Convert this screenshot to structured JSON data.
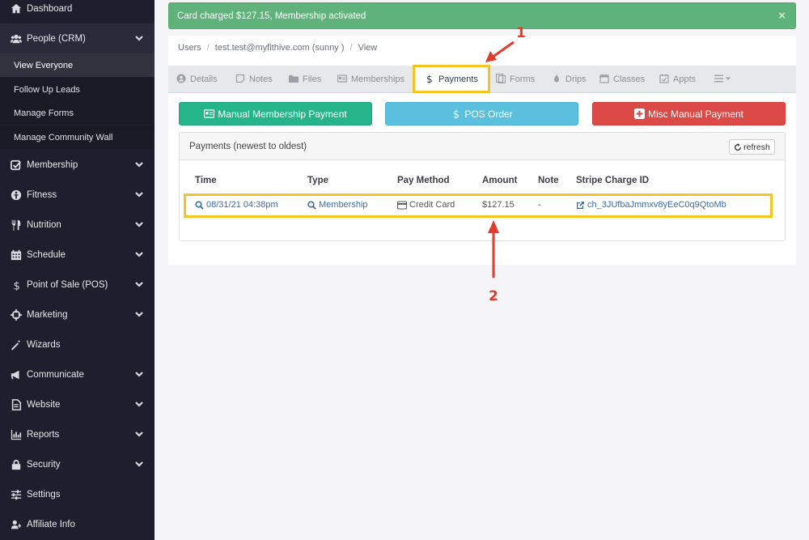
{
  "sidebar": {
    "items": [
      {
        "label": "Dashboard",
        "icon": "home-icon"
      },
      {
        "label": "People (CRM)",
        "icon": "users-icon",
        "open": true
      },
      {
        "label": "Membership",
        "icon": "check-square-icon"
      },
      {
        "label": "Fitness",
        "icon": "fitness-icon"
      },
      {
        "label": "Nutrition",
        "icon": "cutlery-icon"
      },
      {
        "label": "Schedule",
        "icon": "calendar-icon"
      },
      {
        "label": "Point of Sale (POS)",
        "icon": "dollar-icon"
      },
      {
        "label": "Marketing",
        "icon": "crosshair-icon"
      },
      {
        "label": "Wizards",
        "icon": "magic-wand-icon"
      },
      {
        "label": "Communicate",
        "icon": "bullhorn-icon"
      },
      {
        "label": "Website",
        "icon": "file-icon"
      },
      {
        "label": "Reports",
        "icon": "bar-chart-icon"
      },
      {
        "label": "Security",
        "icon": "lock-icon"
      },
      {
        "label": "Settings",
        "icon": "sliders-icon"
      },
      {
        "label": "Affiliate Info",
        "icon": "affiliate-icon"
      }
    ],
    "sub_items": [
      "View Everyone",
      "Follow Up Leads",
      "Manage Forms",
      "Manage Community Wall"
    ]
  },
  "alert": {
    "message": "Card charged $127.15, Membership activated",
    "close": "×"
  },
  "breadcrumb": {
    "users": "Users",
    "user": "test.test@myfithive.com (sunny )",
    "view": "View",
    "sep": "/"
  },
  "tabs": {
    "details": "Details",
    "notes": "Notes",
    "files": "Files",
    "memberships": "Memberships",
    "payments": "Payments",
    "forms": "Forms",
    "drips": "Drips",
    "classes": "Classes",
    "appts": "Appts"
  },
  "buttons": {
    "manual_membership": "Manual Membership Payment",
    "pos_order": "POS Order",
    "misc_manual": "Misc Manual Payment"
  },
  "payments": {
    "title": "Payments (newest to oldest)",
    "refresh": "refresh",
    "columns": [
      "Time",
      "Type",
      "Pay Method",
      "Amount",
      "Note",
      "Stripe Charge ID"
    ],
    "rows": [
      {
        "time": "08/31/21 04:38pm",
        "type": "Membership",
        "pay_method": "Credit Card",
        "amount": "$127.15",
        "note": "-",
        "charge_id": "ch_3JUfbaJmmxv8yEeC0q9QtoMb"
      }
    ]
  },
  "annotations": {
    "one": "1",
    "two": "2"
  },
  "colors": {
    "highlight": "#f2c522",
    "arrow": "#e23b2e",
    "sidebar": "#1e1e2c",
    "alert": "#5fb37a"
  }
}
